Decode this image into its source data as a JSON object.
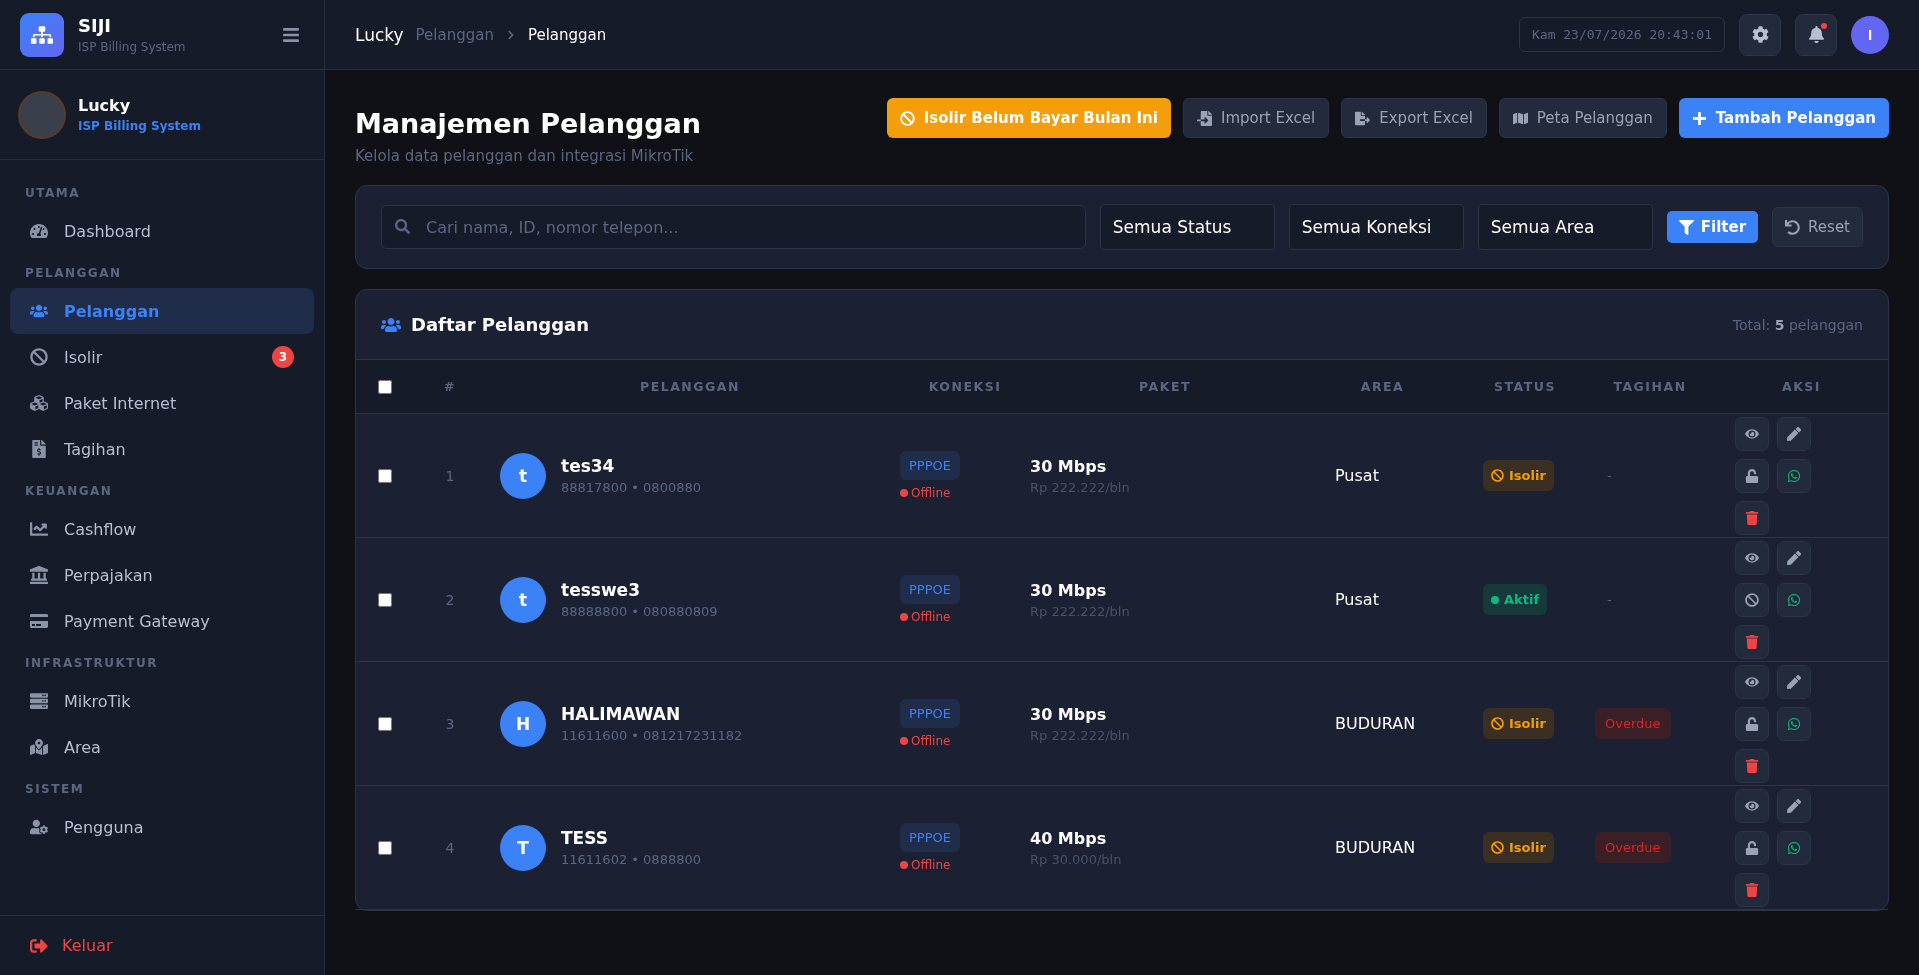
{
  "brand": {
    "name": "SIJI",
    "subtitle": "ISP Billing System"
  },
  "user": {
    "name": "Lucky",
    "role": "ISP Billing System"
  },
  "sidebar": {
    "sections": [
      {
        "label": "UTAMA",
        "items": [
          {
            "label": "Dashboard",
            "selected": false
          }
        ]
      },
      {
        "label": "PELANGGAN",
        "items": [
          {
            "label": "Pelanggan",
            "selected": true
          },
          {
            "label": "Isolir",
            "selected": false,
            "badge": "3"
          },
          {
            "label": "Paket Internet",
            "selected": false
          },
          {
            "label": "Tagihan",
            "selected": false
          }
        ]
      },
      {
        "label": "KEUANGAN",
        "items": [
          {
            "label": "Cashflow",
            "selected": false
          },
          {
            "label": "Perpajakan",
            "selected": false
          },
          {
            "label": "Payment Gateway",
            "selected": false
          }
        ]
      },
      {
        "label": "INFRASTRUKTUR",
        "items": [
          {
            "label": "MikroTik",
            "selected": false
          },
          {
            "label": "Area",
            "selected": false
          }
        ]
      },
      {
        "label": "SISTEM",
        "items": [
          {
            "label": "Pengguna",
            "selected": false
          }
        ]
      }
    ],
    "logout": "Keluar"
  },
  "topbar": {
    "breadcrumb": [
      "Lucky",
      "Pelanggan",
      "Pelanggan"
    ],
    "datetime": "Kam 23/07/2026 20:43:01",
    "has_notification": true,
    "avatar_letter": "I"
  },
  "page": {
    "title": "Manajemen Pelanggan",
    "subtitle": "Kelola data pelanggan dan integrasi MikroTik",
    "actions": [
      {
        "label": "Isolir Belum Bayar Bulan Ini",
        "kind": "warning"
      },
      {
        "label": "Import Excel",
        "kind": "import"
      },
      {
        "label": "Export Excel",
        "kind": "export"
      },
      {
        "label": "Peta Pelanggan",
        "kind": "map"
      },
      {
        "label": "Tambah Pelanggan",
        "kind": "primary"
      }
    ]
  },
  "filters": {
    "search": {
      "placeholder": "Cari nama, ID, nomor telepon..."
    },
    "selects": [
      "Semua Status",
      "Semua Koneksi",
      "Semua Area"
    ],
    "filter_button": "Filter",
    "reset_button": "Reset"
  },
  "table": {
    "title": "Daftar Pelanggan",
    "total_prefix": "Total:",
    "total_count": "5",
    "total_suffix": "pelanggan",
    "header_checked": false,
    "columns": [
      "#",
      "PELANGGAN",
      "KONEKSI",
      "PAKET",
      "AREA",
      "STATUS",
      "TAGIHAN",
      "AKSI"
    ],
    "rows": [
      {
        "checked": false,
        "no": "1",
        "initial": "t",
        "name": "tes34",
        "meta": "88817800 • 0800880",
        "connection": "PPPOE",
        "online": false,
        "online_label": "Offline",
        "speed": "30 Mbps",
        "price": "Rp 222.222/bln",
        "area": "Pusat",
        "status": {
          "kind": "isolir",
          "label": "Isolir"
        },
        "bill": {
          "kind": "none",
          "label": "-"
        }
      },
      {
        "checked": false,
        "no": "2",
        "initial": "t",
        "name": "tesswe3",
        "meta": "88888800 • 080880809",
        "connection": "PPPOE",
        "online": false,
        "online_label": "Offline",
        "speed": "30 Mbps",
        "price": "Rp 222.222/bln",
        "area": "Pusat",
        "status": {
          "kind": "aktif",
          "label": "Aktif"
        },
        "bill": {
          "kind": "none",
          "label": "-"
        }
      },
      {
        "checked": false,
        "no": "3",
        "initial": "H",
        "name": "HALIMAWAN",
        "meta": "11611600 • 081217231182",
        "connection": "PPPOE",
        "online": false,
        "online_label": "Offline",
        "speed": "30 Mbps",
        "price": "Rp 222.222/bln",
        "area": "BUDURAN",
        "status": {
          "kind": "isolir",
          "label": "Isolir"
        },
        "bill": {
          "kind": "overdue",
          "label": "Overdue"
        }
      },
      {
        "checked": false,
        "no": "4",
        "initial": "T",
        "name": "TESS",
        "meta": "11611602 • 0888800",
        "connection": "PPPOE",
        "online": false,
        "online_label": "Offline",
        "speed": "40 Mbps",
        "price": "Rp 30.000/bln",
        "area": "BUDURAN",
        "status": {
          "kind": "isolir",
          "label": "Isolir"
        },
        "bill": {
          "kind": "overdue",
          "label": "Overdue"
        }
      }
    ]
  }
}
